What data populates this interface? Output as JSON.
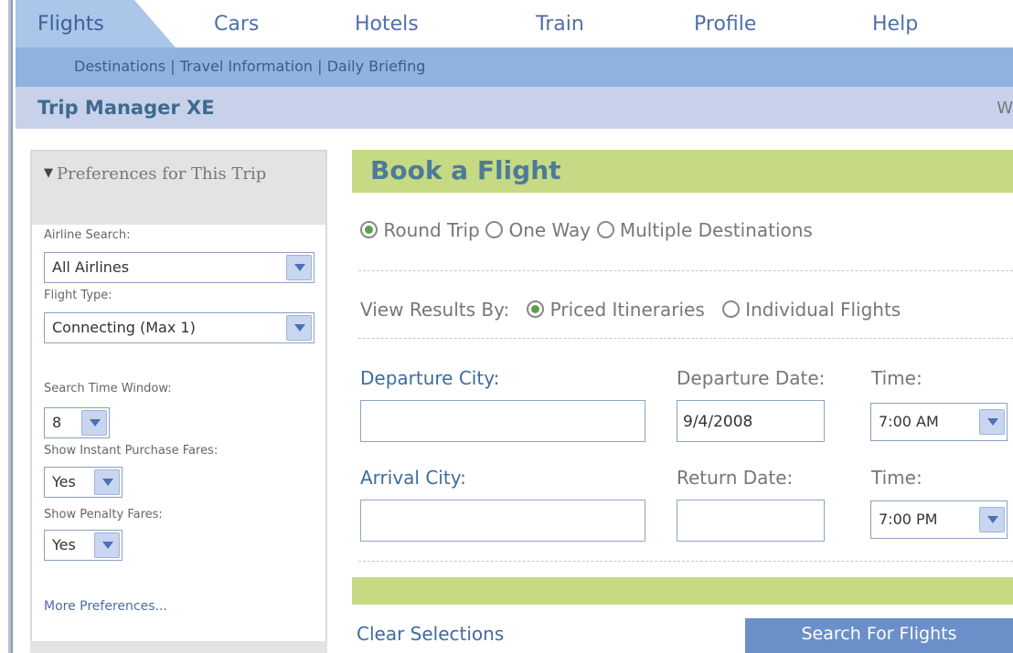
{
  "nav": {
    "tabs": [
      {
        "label": "Flights",
        "active": true
      },
      {
        "label": "Cars"
      },
      {
        "label": "Hotels"
      },
      {
        "label": "Train"
      },
      {
        "label": "Profile"
      },
      {
        "label": "Help"
      }
    ]
  },
  "subnav": {
    "links": [
      "Destinations",
      "Travel Information",
      "Daily Briefing"
    ],
    "separator": "|"
  },
  "header": {
    "title": "Trip Manager XE",
    "right_truncated": "W"
  },
  "sidebar": {
    "heading": "Preferences for This Trip",
    "airline_search": {
      "label": "Airline Search:",
      "value": "All Airlines"
    },
    "flight_type": {
      "label": "Flight Type:",
      "value": "Connecting (Max 1)"
    },
    "search_time_window": {
      "label": "Search Time Window:",
      "value": "8"
    },
    "instant_purchase": {
      "label": "Show Instant Purchase Fares:",
      "value": "Yes"
    },
    "penalty_fares": {
      "label": "Show Penalty Fares:",
      "value": "Yes"
    },
    "more_link": "More Preferences..."
  },
  "main": {
    "title": "Book a Flight",
    "trip_types": [
      {
        "label": "Round Trip",
        "selected": true
      },
      {
        "label": "One Way",
        "selected": false
      },
      {
        "label": "Multiple Destinations",
        "selected": false
      }
    ],
    "view_results": {
      "label": "View Results By:",
      "options": [
        {
          "label": "Priced Itineraries",
          "selected": true
        },
        {
          "label": "Individual Flights",
          "selected": false
        }
      ]
    },
    "departure_city": {
      "label": "Departure City:",
      "value": ""
    },
    "departure_date": {
      "label": "Departure Date:",
      "value": "9/4/2008"
    },
    "departure_time": {
      "label": "Time:",
      "value": "7:00 AM"
    },
    "arrival_city": {
      "label": "Arrival City:",
      "value": ""
    },
    "return_date": {
      "label": "Return Date:",
      "value": ""
    },
    "return_time": {
      "label": "Time:",
      "value": "7:00 PM"
    },
    "clear_label": "Clear Selections",
    "search_label": "Search For Flights"
  },
  "colors": {
    "nav_active": "#aac6e8",
    "subnav_bg": "#8fb3df",
    "title_bar": "#c7d1ea",
    "banner_green": "#c6d983",
    "search_button": "#6b8fc8"
  }
}
